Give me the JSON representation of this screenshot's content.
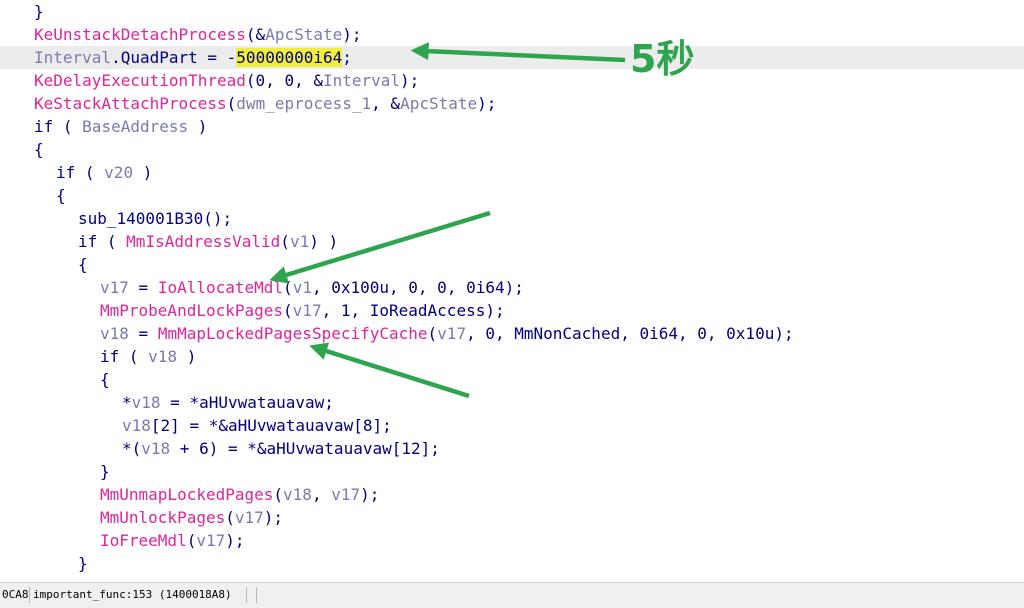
{
  "colors": {
    "keyword": "#000080",
    "function": "#e0249b",
    "variable": "#7a7ab0",
    "highlight": "#f0f03c",
    "annotation": "#2ea44f",
    "current_line": "#ececec"
  },
  "code": {
    "current_line_index": 2,
    "lines": [
      {
        "indent": 1,
        "tokens": [
          {
            "t": "}",
            "c": "plain"
          }
        ]
      },
      {
        "indent": 1,
        "tokens": [
          {
            "t": "KeUnstackDetachProcess",
            "c": "func"
          },
          {
            "t": "(&",
            "c": "plain"
          },
          {
            "t": "ApcState",
            "c": "var"
          },
          {
            "t": ");",
            "c": "plain"
          }
        ]
      },
      {
        "indent": 1,
        "tokens": [
          {
            "t": "Interval",
            "c": "var"
          },
          {
            "t": ".QuadPart = -",
            "c": "plain"
          },
          {
            "t": "50000000i64",
            "c": "hl"
          },
          {
            "t": ";",
            "c": "plain"
          }
        ]
      },
      {
        "indent": 1,
        "tokens": [
          {
            "t": "KeDelayExecutionThread",
            "c": "func"
          },
          {
            "t": "(0, 0, &",
            "c": "plain"
          },
          {
            "t": "Interval",
            "c": "var"
          },
          {
            "t": ");",
            "c": "plain"
          }
        ]
      },
      {
        "indent": 1,
        "tokens": [
          {
            "t": "KeStackAttachProcess",
            "c": "func"
          },
          {
            "t": "(",
            "c": "plain"
          },
          {
            "t": "dwm_eprocess_1",
            "c": "var"
          },
          {
            "t": ", &",
            "c": "plain"
          },
          {
            "t": "ApcState",
            "c": "var"
          },
          {
            "t": ");",
            "c": "plain"
          }
        ]
      },
      {
        "indent": 1,
        "tokens": [
          {
            "t": "if ( ",
            "c": "plain"
          },
          {
            "t": "BaseAddress",
            "c": "var"
          },
          {
            "t": " )",
            "c": "plain"
          }
        ]
      },
      {
        "indent": 1,
        "tokens": [
          {
            "t": "{",
            "c": "plain"
          }
        ]
      },
      {
        "indent": 2,
        "tokens": [
          {
            "t": "if ( ",
            "c": "plain"
          },
          {
            "t": "v20",
            "c": "var"
          },
          {
            "t": " )",
            "c": "plain"
          }
        ]
      },
      {
        "indent": 2,
        "tokens": [
          {
            "t": "{",
            "c": "plain"
          }
        ]
      },
      {
        "indent": 3,
        "tokens": [
          {
            "t": "sub_140001B30();",
            "c": "plain"
          }
        ]
      },
      {
        "indent": 3,
        "tokens": [
          {
            "t": "if ( ",
            "c": "plain"
          },
          {
            "t": "MmIsAddressValid",
            "c": "func"
          },
          {
            "t": "(",
            "c": "plain"
          },
          {
            "t": "v1",
            "c": "var"
          },
          {
            "t": ") )",
            "c": "plain"
          }
        ]
      },
      {
        "indent": 3,
        "tokens": [
          {
            "t": "{",
            "c": "plain"
          }
        ]
      },
      {
        "indent": 4,
        "tokens": [
          {
            "t": "v17",
            "c": "var"
          },
          {
            "t": " = ",
            "c": "plain"
          },
          {
            "t": "IoAllocateMdl",
            "c": "func"
          },
          {
            "t": "(",
            "c": "plain"
          },
          {
            "t": "v1",
            "c": "var"
          },
          {
            "t": ", 0x100u, 0, 0, 0i64);",
            "c": "plain"
          }
        ]
      },
      {
        "indent": 4,
        "tokens": [
          {
            "t": "MmProbeAndLockPages",
            "c": "func"
          },
          {
            "t": "(",
            "c": "plain"
          },
          {
            "t": "v17",
            "c": "var"
          },
          {
            "t": ", 1, IoReadAccess);",
            "c": "plain"
          }
        ]
      },
      {
        "indent": 4,
        "tokens": [
          {
            "t": "v18",
            "c": "var"
          },
          {
            "t": " = ",
            "c": "plain"
          },
          {
            "t": "MmMapLockedPagesSpecifyCache",
            "c": "func"
          },
          {
            "t": "(",
            "c": "plain"
          },
          {
            "t": "v17",
            "c": "var"
          },
          {
            "t": ", 0, MmNonCached, 0i64, 0, 0x10u);",
            "c": "plain"
          }
        ]
      },
      {
        "indent": 4,
        "tokens": [
          {
            "t": "if ( ",
            "c": "plain"
          },
          {
            "t": "v18",
            "c": "var"
          },
          {
            "t": " )",
            "c": "plain"
          }
        ]
      },
      {
        "indent": 4,
        "tokens": [
          {
            "t": "{",
            "c": "plain"
          }
        ]
      },
      {
        "indent": 5,
        "tokens": [
          {
            "t": "*",
            "c": "plain"
          },
          {
            "t": "v18",
            "c": "var"
          },
          {
            "t": " = *aHUvwatauavaw;",
            "c": "plain"
          }
        ]
      },
      {
        "indent": 5,
        "tokens": [
          {
            "t": "v18",
            "c": "var"
          },
          {
            "t": "[2] = *&aHUvwatauavaw[8];",
            "c": "plain"
          }
        ]
      },
      {
        "indent": 5,
        "tokens": [
          {
            "t": "*(",
            "c": "plain"
          },
          {
            "t": "v18",
            "c": "var"
          },
          {
            "t": " + 6) = *&aHUvwatauavaw[12];",
            "c": "plain"
          }
        ]
      },
      {
        "indent": 4,
        "tokens": [
          {
            "t": "}",
            "c": "plain"
          }
        ]
      },
      {
        "indent": 4,
        "tokens": [
          {
            "t": "MmUnmapLockedPages",
            "c": "func"
          },
          {
            "t": "(",
            "c": "plain"
          },
          {
            "t": "v18",
            "c": "var"
          },
          {
            "t": ", ",
            "c": "plain"
          },
          {
            "t": "v17",
            "c": "var"
          },
          {
            "t": ");",
            "c": "plain"
          }
        ]
      },
      {
        "indent": 4,
        "tokens": [
          {
            "t": "MmUnlockPages",
            "c": "func"
          },
          {
            "t": "(",
            "c": "plain"
          },
          {
            "t": "v17",
            "c": "var"
          },
          {
            "t": ");",
            "c": "plain"
          }
        ]
      },
      {
        "indent": 4,
        "tokens": [
          {
            "t": "IoFreeMdl",
            "c": "func"
          },
          {
            "t": "(",
            "c": "plain"
          },
          {
            "t": "v17",
            "c": "var"
          },
          {
            "t": ");",
            "c": "plain"
          }
        ]
      },
      {
        "indent": 3,
        "tokens": [
          {
            "t": "}",
            "c": "plain"
          }
        ]
      }
    ]
  },
  "annotation": {
    "label": "5秒",
    "arrow_icons": [
      "arrow-to-interval",
      "arrow-to-ioallocatemdl",
      "arrow-to-mmmaplockedpages"
    ]
  },
  "status_bar": {
    "address": "0CA8",
    "location": "important_func:153 (1400018A8)"
  }
}
